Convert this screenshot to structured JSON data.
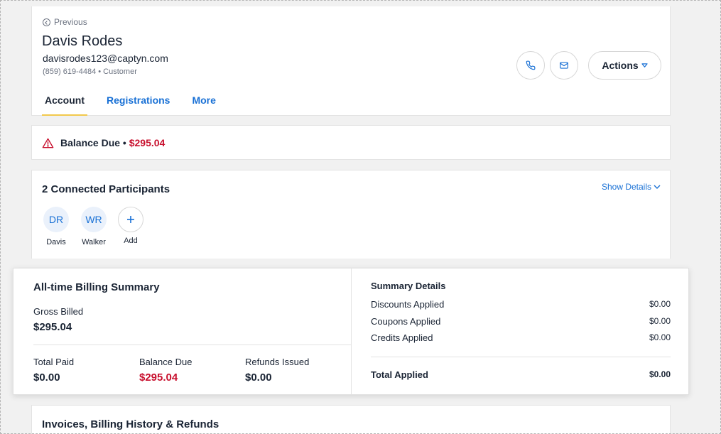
{
  "header": {
    "previous_label": "Previous",
    "name": "Davis Rodes",
    "email": "davisrodes123@captyn.com",
    "meta": "(859) 619-4484 • Customer",
    "actions_label": "Actions"
  },
  "tabs": [
    {
      "label": "Account",
      "active": true
    },
    {
      "label": "Registrations",
      "active": false
    },
    {
      "label": "More",
      "active": false
    }
  ],
  "balance_banner": {
    "label": "Balance Due •",
    "amount": "$295.04"
  },
  "participants": {
    "title": "2 Connected Participants",
    "show_details": "Show Details",
    "items": [
      {
        "initials": "DR",
        "name": "Davis"
      },
      {
        "initials": "WR",
        "name": "Walker"
      }
    ],
    "add_label": "Add"
  },
  "billing_summary": {
    "title": "All-time Billing Summary",
    "gross_label": "Gross Billed",
    "gross_value": "$295.04",
    "total_paid_label": "Total Paid",
    "total_paid_value": "$0.00",
    "balance_due_label": "Balance Due",
    "balance_due_value": "$295.04",
    "refunds_label": "Refunds Issued",
    "refunds_value": "$0.00"
  },
  "summary_details": {
    "title": "Summary Details",
    "rows": [
      {
        "label": "Discounts Applied",
        "value": "$0.00"
      },
      {
        "label": "Coupons Applied",
        "value": "$0.00"
      },
      {
        "label": "Credits Applied",
        "value": "$0.00"
      }
    ],
    "total_label": "Total Applied",
    "total_value": "$0.00"
  },
  "invoices": {
    "title": "Invoices, Billing History & Refunds"
  },
  "colors": {
    "accent_blue": "#1870d5",
    "alert_red": "#c8102e",
    "tab_underline": "#f2c94c"
  }
}
